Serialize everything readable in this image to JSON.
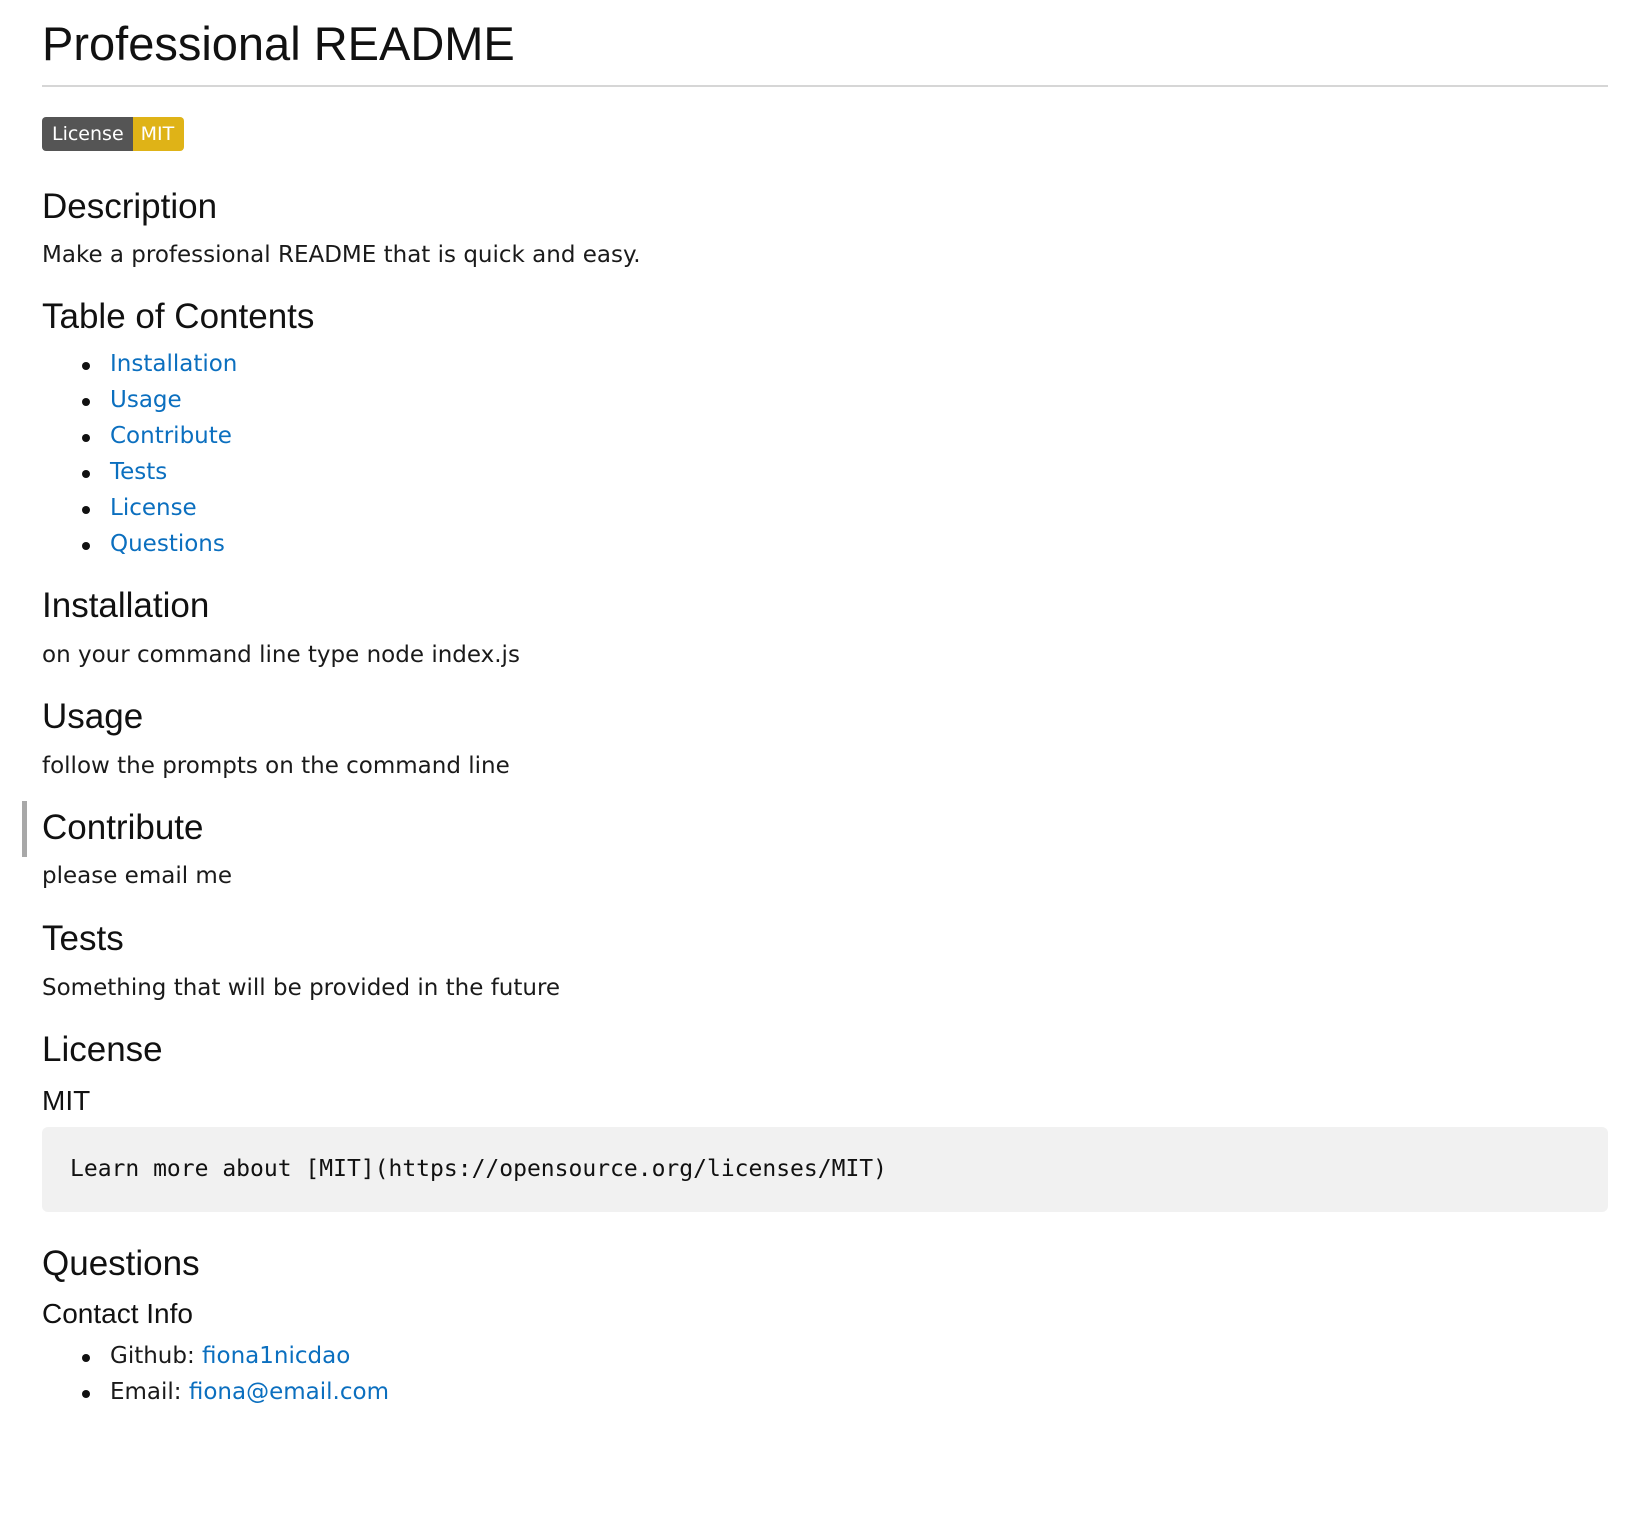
{
  "title": "Professional README",
  "badge": {
    "label": "License",
    "value": "MIT",
    "label_color": "#555555",
    "value_color": "#dfb317"
  },
  "description": {
    "heading": "Description",
    "text": "Make a professional README that is quick and easy."
  },
  "toc": {
    "heading": "Table of Contents",
    "items": [
      {
        "label": "Installation"
      },
      {
        "label": "Usage"
      },
      {
        "label": "Contribute"
      },
      {
        "label": "Tests"
      },
      {
        "label": "License"
      },
      {
        "label": "Questions"
      }
    ]
  },
  "installation": {
    "heading": "Installation",
    "text": "on your command line type node index.js"
  },
  "usage": {
    "heading": "Usage",
    "text": "follow the prompts on the command line"
  },
  "contribute": {
    "heading": "Contribute",
    "text": "please email me"
  },
  "tests": {
    "heading": "Tests",
    "text": "Something that will be provided in the future"
  },
  "license": {
    "heading": "License",
    "name": "MIT",
    "code": "Learn more about [MIT](https://opensource.org/licenses/MIT)"
  },
  "questions": {
    "heading": "Questions",
    "subheading": "Contact Info",
    "github_label": "Github: ",
    "github_value": "fiona1nicdao",
    "email_label": "Email: ",
    "email_value": "fiona@email.com"
  },
  "colors": {
    "link": "#0b6fbf",
    "code_background": "#f1f1f1",
    "rule": "#d6d6d6",
    "focus_bar": "#a8a8a8"
  }
}
